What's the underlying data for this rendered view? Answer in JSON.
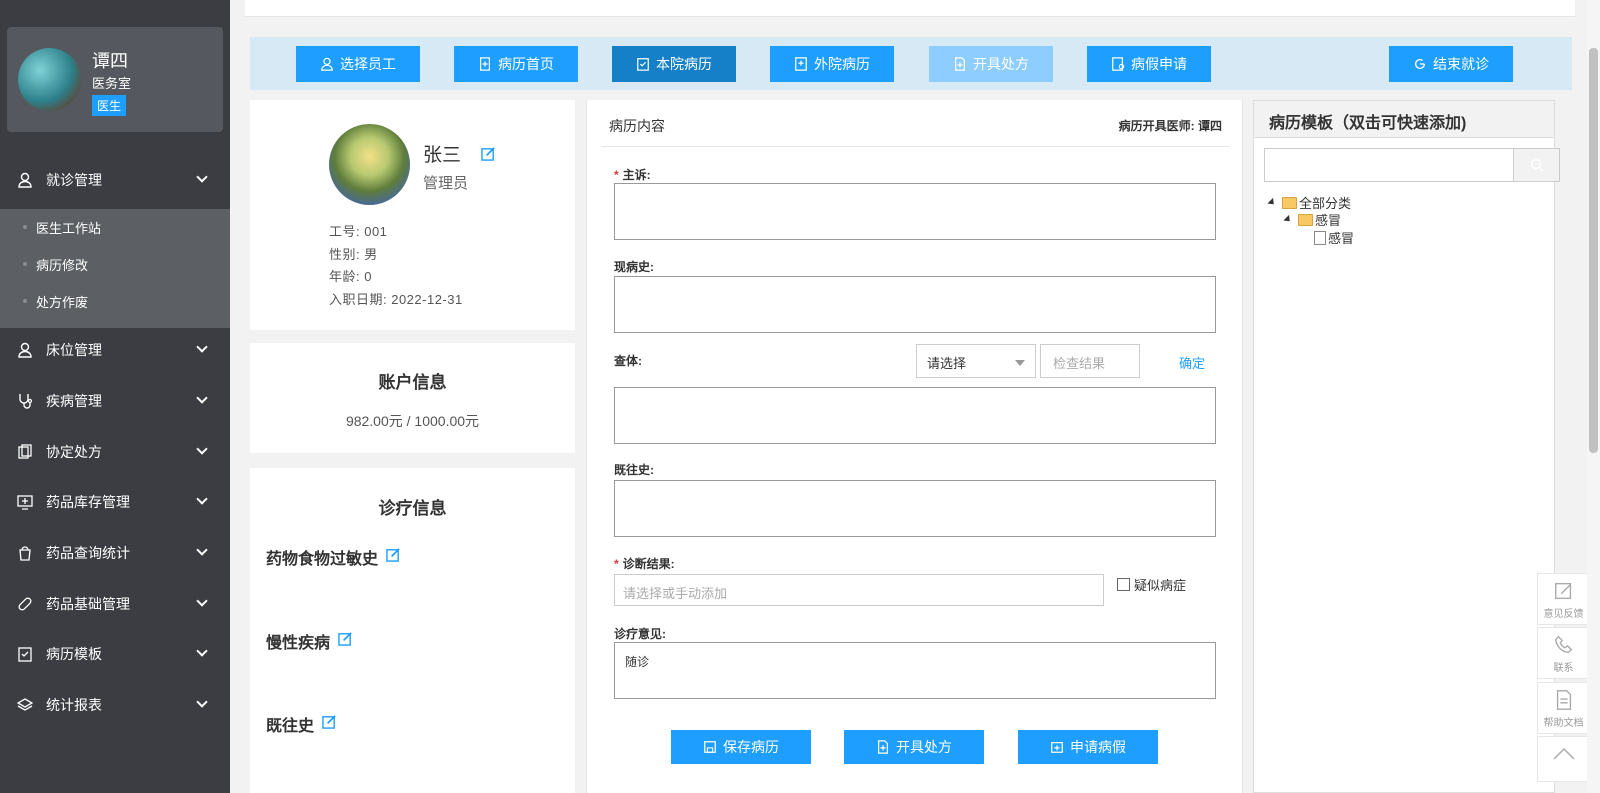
{
  "user": {
    "name": "谭四",
    "dept": "医务室",
    "role": "医生"
  },
  "sidebar": {
    "items": [
      {
        "label": "就诊管理",
        "icon": "user-icon"
      },
      {
        "label": "床位管理",
        "icon": "user-icon"
      },
      {
        "label": "疾病管理",
        "icon": "stethoscope-icon"
      },
      {
        "label": "协定处方",
        "icon": "clipboard-icon"
      },
      {
        "label": "药品库存管理",
        "icon": "monitor-icon"
      },
      {
        "label": "药品查询统计",
        "icon": "bag-icon"
      },
      {
        "label": "药品基础管理",
        "icon": "pill-icon"
      },
      {
        "label": "病历模板",
        "icon": "checklist-icon"
      },
      {
        "label": "统计报表",
        "icon": "layers-icon"
      }
    ],
    "submenu": [
      "医生工作站",
      "病历修改",
      "处方作废"
    ]
  },
  "toolbar": {
    "buttons": [
      "选择员工",
      "病历首页",
      "本院病历",
      "外院病历",
      "开具处方",
      "病假申请",
      "结束就诊"
    ]
  },
  "patient": {
    "name": "张三",
    "role": "管理员",
    "employee_no": "工号: 001",
    "gender": "性别: 男",
    "age": "年龄: 0",
    "hire_date": "入职日期: 2022-12-31"
  },
  "account": {
    "title": "账户信息",
    "balance": "982.00元 / 1000.00元"
  },
  "diagnosis_info": {
    "title": "诊疗信息",
    "items": [
      "药物食物过敏史",
      "慢性疾病",
      "既往史"
    ]
  },
  "form": {
    "title": "病历内容",
    "doctor": "病历开具医师: 谭四",
    "chief_complaint_label": "主诉:",
    "present_illness_label": "现病史:",
    "physical_exam_label": "查体:",
    "select_placeholder": "请选择",
    "check_result_placeholder": "检查结果",
    "confirm_label": "确定",
    "past_history_label": "既往史:",
    "diagnosis_label": "诊断结果:",
    "diagnosis_placeholder": "请选择或手动添加",
    "suspect_label": "疑似病症",
    "opinion_label": "诊疗意见:",
    "opinion_value": "随诊",
    "buttons": [
      "保存病历",
      "开具处方",
      "申请病假"
    ]
  },
  "templates": {
    "title": "病历模板（双击可快速添加)",
    "tree": [
      "全部分类",
      "感冒",
      "感冒"
    ]
  },
  "float_tools": [
    "意见反馈",
    "联系",
    "帮助文档"
  ]
}
